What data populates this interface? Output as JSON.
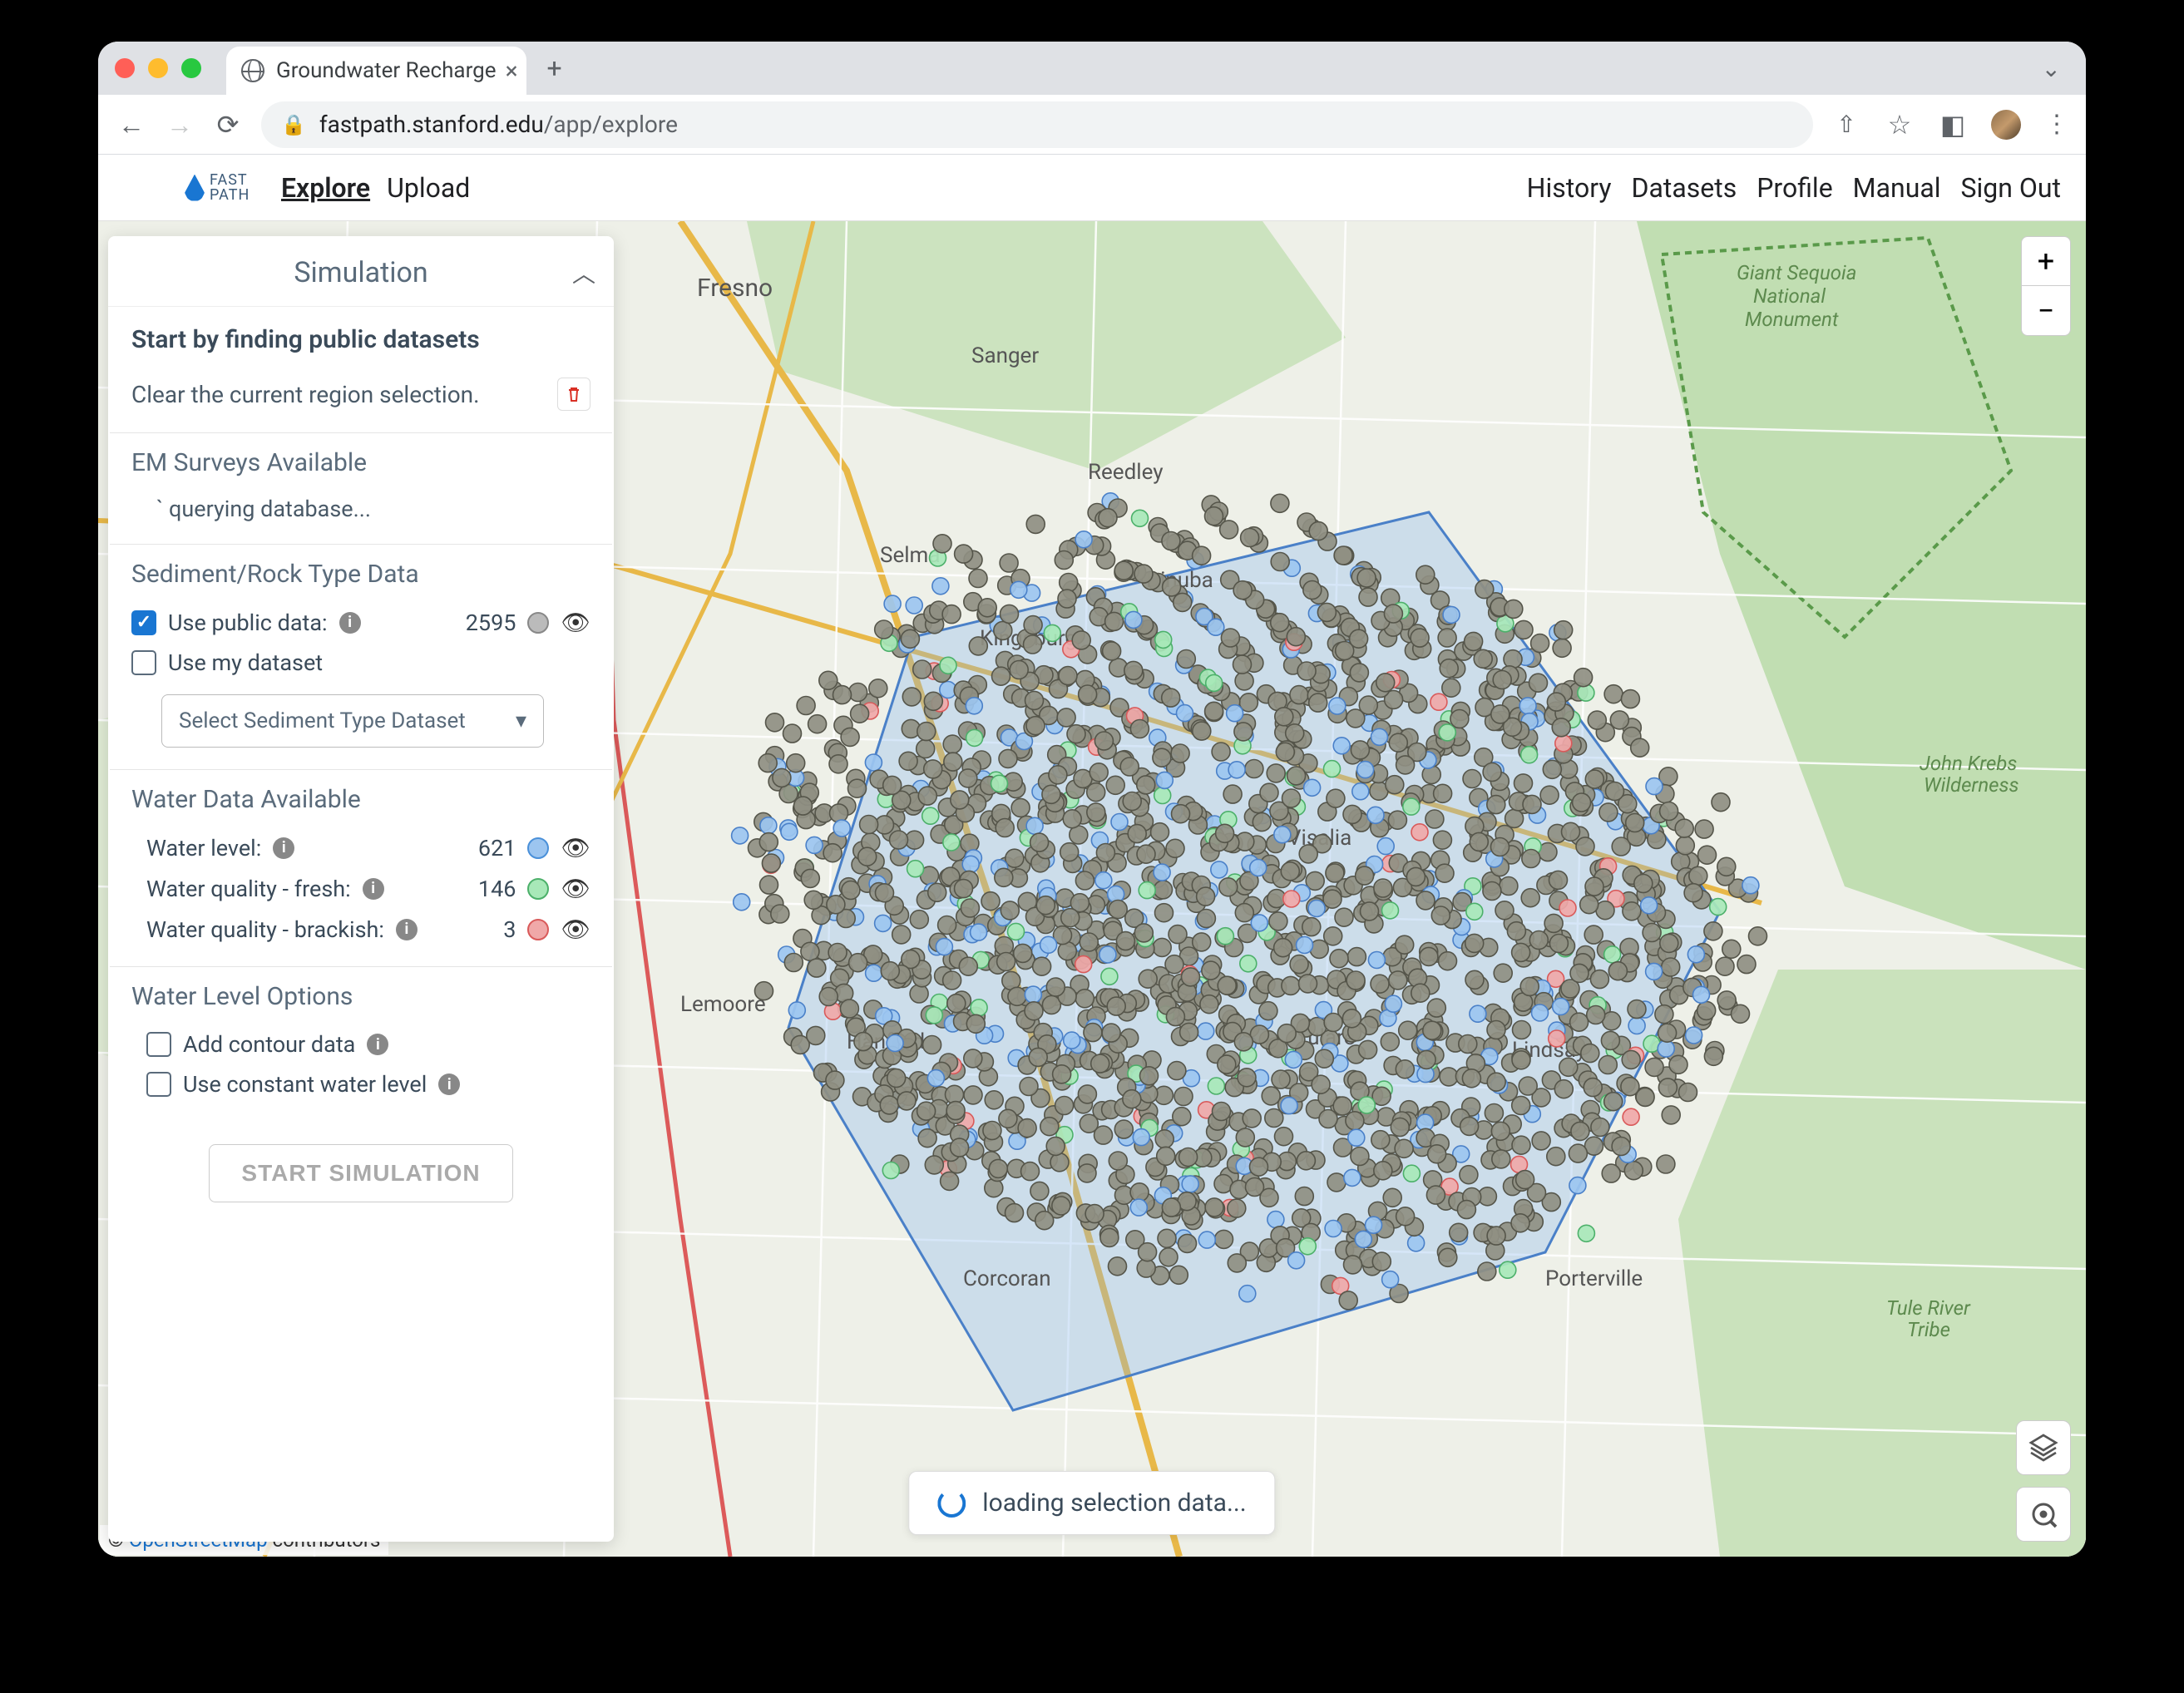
{
  "browser": {
    "tab_title": "Groundwater Recharge",
    "url_domain": "fastpath.stanford.edu",
    "url_path": "/app/explore"
  },
  "header": {
    "logo_line1": "FAST",
    "logo_line2": "PATH",
    "left_nav": {
      "explore": "Explore",
      "upload": "Upload"
    },
    "right_nav": {
      "history": "History",
      "datasets": "Datasets",
      "profile": "Profile",
      "manual": "Manual",
      "signout": "Sign Out"
    }
  },
  "panel": {
    "title": "Simulation",
    "start_heading": "Start by finding public datasets",
    "clear_text": "Clear the current region selection.",
    "em_heading": "EM Surveys Available",
    "em_status": "` querying database...",
    "sediment": {
      "heading": "Sediment/Rock Type Data",
      "use_public_label": "Use public data:",
      "public_count": "2595",
      "use_my_label": "Use my dataset",
      "select_placeholder": "Select Sediment Type Dataset"
    },
    "water": {
      "heading": "Water Data Available",
      "level_label": "Water level:",
      "level_count": "621",
      "fresh_label": "Water quality - fresh:",
      "fresh_count": "146",
      "brackish_label": "Water quality - brackish:",
      "brackish_count": "3"
    },
    "level_options": {
      "heading": "Water Level Options",
      "contour_label": "Add contour data",
      "constant_label": "Use constant water level"
    },
    "start_button": "START SIMULATION"
  },
  "map": {
    "labels": {
      "fresno": "Fresno",
      "sanger": "Sanger",
      "selma": "Selma",
      "reedley": "Reedley",
      "kingsburg": "Kingsburg",
      "dinuba": "Dinuba",
      "lemoore": "Lemoore",
      "hanford": "Hanford",
      "corcoran": "Corcoran",
      "visalia": "Visalia",
      "tulare": "Tulare",
      "lindsay": "Lindsay",
      "porterville": "Porterville",
      "gsnm": "Giant Sequoia\nNational\nMonument",
      "jkw": "John Krebs\nWilderness",
      "trt": "Tule River\nTribe"
    },
    "zoom_in": "+",
    "zoom_out": "−",
    "loading": "loading selection data...",
    "attribution_prefix": "© ",
    "attribution_link": "OpenStreetMap",
    "attribution_suffix": " contributors"
  }
}
